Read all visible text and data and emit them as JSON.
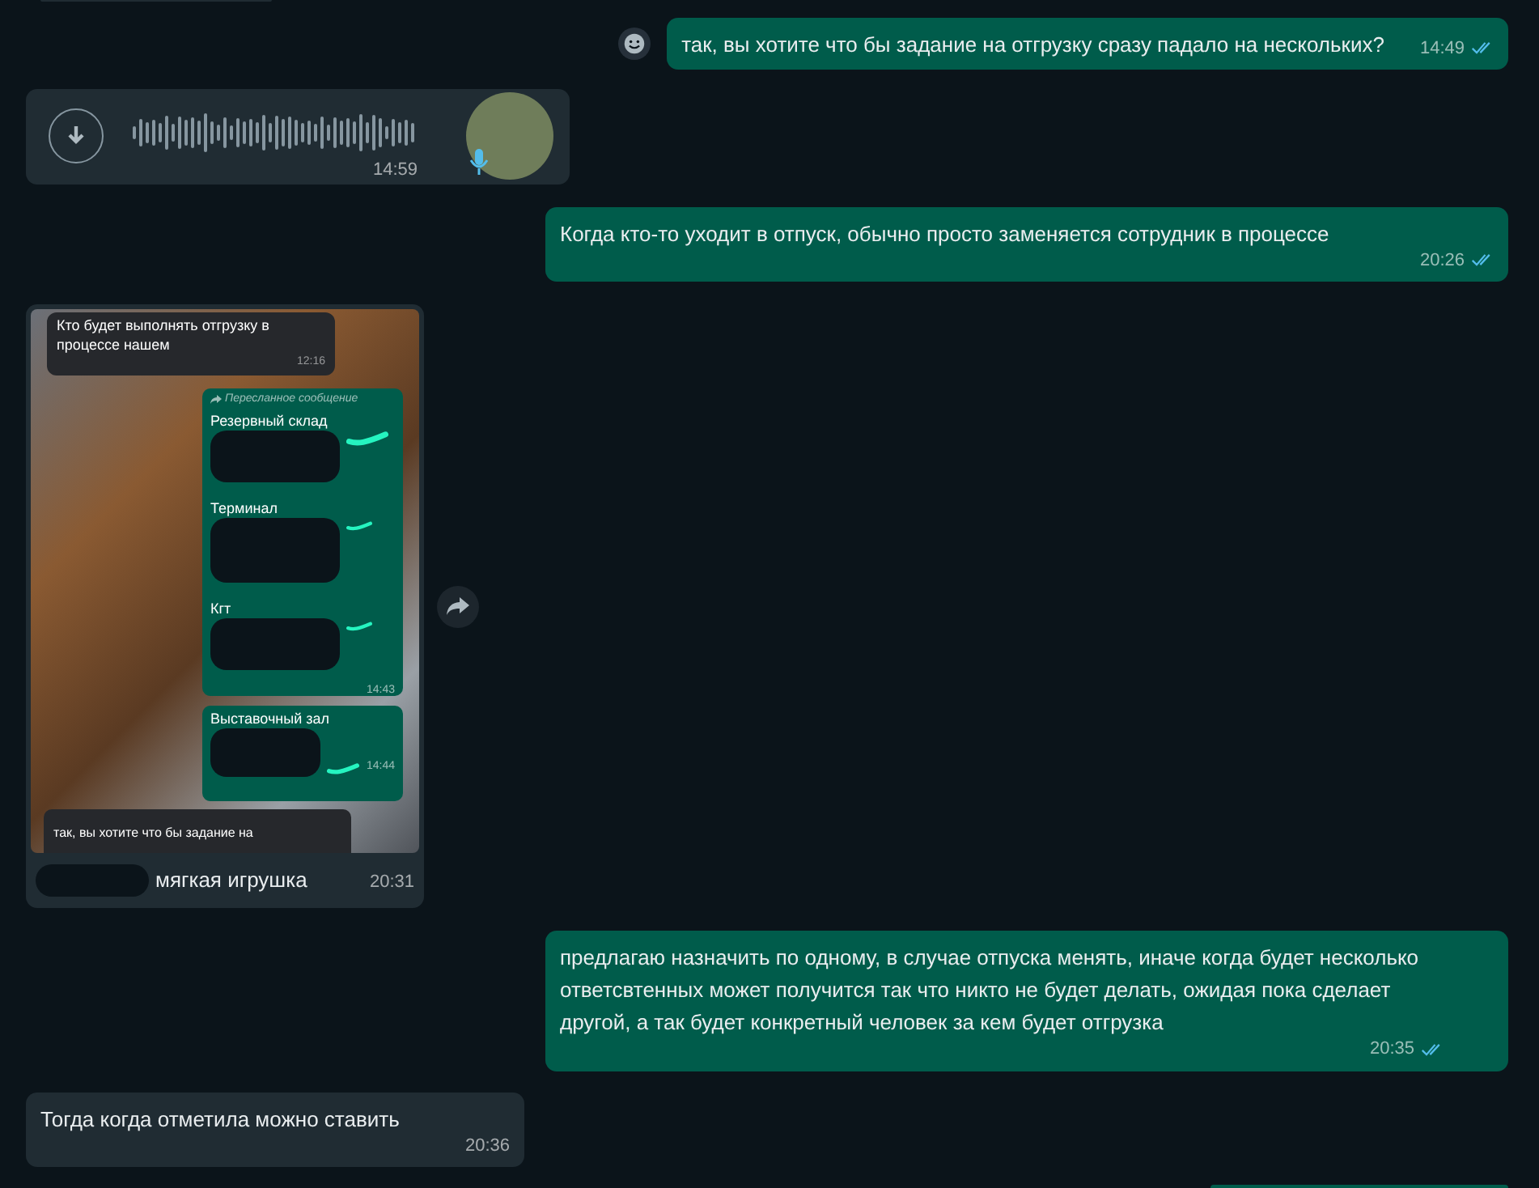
{
  "messages": [
    {
      "kind": "stub",
      "outgoing": false
    },
    {
      "kind": "text",
      "outgoing": true,
      "text": "так, вы хотите что бы задание на отгрузку сразу падало на нескольких?",
      "time": "14:49",
      "read": true,
      "emoji_button": true
    },
    {
      "kind": "voice",
      "outgoing": false,
      "time": "14:59"
    },
    {
      "kind": "text",
      "outgoing": true,
      "text": "Когда кто-то уходит в отпуск, обычно просто заменяется сотрудник в процессе",
      "time": "20:26",
      "read": true
    },
    {
      "kind": "image",
      "outgoing": false,
      "caption": "мягкая игрушка",
      "time": "20:31",
      "forward_button": true,
      "screenshot": {
        "top_bubble": {
          "text": "Кто будет выполнять отгрузку в процессе нашем",
          "time": "12:16"
        },
        "forwarded": {
          "label": "Пересланное сообщение",
          "items": [
            {
              "text": "Резервный склад"
            },
            {
              "text": "Терминал"
            },
            {
              "text": "Кгт"
            }
          ],
          "time": "14:43"
        },
        "second": {
          "text": "Выставочный зал",
          "time": "14:44"
        },
        "bottom_bubble": {
          "text": "так, вы хотите что бы задание на"
        }
      }
    },
    {
      "kind": "text",
      "outgoing": true,
      "text": "предлагаю назначить по одному, в случае отпуска менять, иначе когда будет несколько ответсвтенных может получится так что никто не будет делать, ожидая пока сделает другой, а так будет конкретный человек за кем будет отгрузка",
      "time": "20:35",
      "read": true
    },
    {
      "kind": "text",
      "outgoing": false,
      "text": "Тогда когда отметила можно ставить",
      "time": "20:36"
    },
    {
      "kind": "stub",
      "outgoing": true
    }
  ]
}
